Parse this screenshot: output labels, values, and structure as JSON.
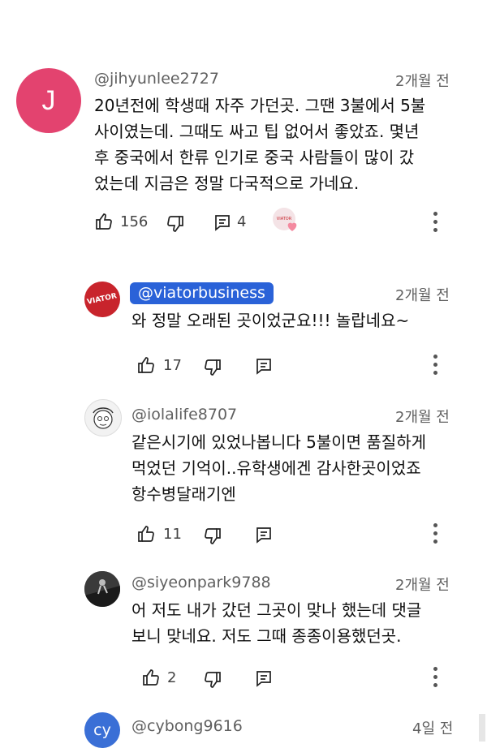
{
  "comments": [
    {
      "avatar_letter": "J",
      "avatar_color": "#e3436f",
      "handle": "@jihyunlee2727",
      "time": "2개월 전",
      "text": "20년전에 학생때 자주 가던곳. 그땐 3불에서 5불\n사이였는데. 그때도 싸고 팁 없어서 좋았죠. 몇년\n후 중국에서 한류 인기로 중국 사람들이 많이 갔\n었는데 지금은 정말 다국적으로 가네요.",
      "likes": "156",
      "replies": "4",
      "creator_badge_text": "VIATOR"
    },
    {
      "avatar_text": "VIATOR",
      "avatar_color": "#c8242c",
      "handle": "@viatorbusiness",
      "time": "2개월 전",
      "text": "와 정말 오래된 곳이었군요!!! 놀랍네요~",
      "likes": "17"
    },
    {
      "handle": "@iolalife8707",
      "time": "2개월 전",
      "text": "같은시기에 있었나봅니다 5불이면 품질하게\n먹었던 기억이..유학생에겐 감사한곳이었죠\n항수병달래기엔",
      "likes": "11"
    },
    {
      "handle": "@siyeonpark9788",
      "time": "2개월 전",
      "text": "어 저도 내가 갔던 그곳이 맞나 했는데 댓글\n보니 맞네요. 저도 그때 종종이용했던곳.",
      "likes": "2"
    },
    {
      "avatar_letter": "cy",
      "avatar_color": "#3a6fd6",
      "handle": "@cybong9616",
      "time": "4일 전"
    }
  ]
}
